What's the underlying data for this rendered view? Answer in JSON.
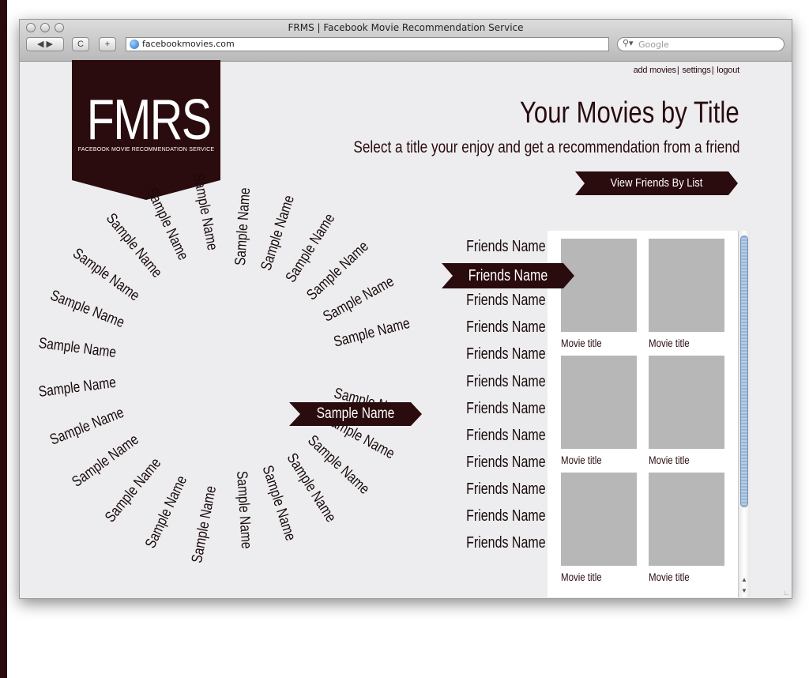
{
  "window": {
    "title": "FRMS | Facebook Movie Recommendation Service",
    "url": "facebookmovies.com",
    "search_placeholder": "Google"
  },
  "toolbar": {
    "back": "◀ ▶",
    "reload": "C",
    "add": "+"
  },
  "top_links": {
    "add_movies": "add movies",
    "settings": "settings",
    "logout": "logout"
  },
  "logo": {
    "mark": "FMRS",
    "tagline": "FACEBOOK MOVIE RECOMMENDATION SERVICE"
  },
  "header": {
    "title": "Your Movies by Title",
    "subtitle": "Select a title your enjoy and get a recommendation from a friend",
    "view_button": "View Friends By List"
  },
  "wheel": {
    "selected": "Sample Name",
    "names": [
      "Sample Name",
      "Sample Name",
      "Sample Name",
      "Sample Name",
      "Sample Name",
      "Sample Name",
      "Sample Name",
      "Sample Name",
      "Sample Name",
      "Sample Name",
      "Sample Name",
      "Sample Name",
      "Sample Name",
      "Sample Name",
      "Sample Name",
      "Sample Name",
      "Sample Name",
      "Sample Name",
      "Sample Name",
      "Sample Name",
      "Sample Name",
      "Sample Name",
      "Sample Name",
      "Sample Name"
    ]
  },
  "friends": {
    "selected_index": 1,
    "names": [
      "Friends Name",
      "Friends Name",
      "Friends Name",
      "Friends Name",
      "Friends Name",
      "Friends Name",
      "Friends Name",
      "Friends Name",
      "Friends Name",
      "Friends Name",
      "Friends Name",
      "Friends Name"
    ]
  },
  "movies": [
    {
      "title": "Movie title"
    },
    {
      "title": "Movie title"
    },
    {
      "title": "Movie title"
    },
    {
      "title": "Movie title"
    },
    {
      "title": "Movie title"
    },
    {
      "title": "Movie title"
    }
  ],
  "colors": {
    "brand": "#2a0b0e",
    "background": "#ededef",
    "thumb": "#b7b7b7"
  }
}
